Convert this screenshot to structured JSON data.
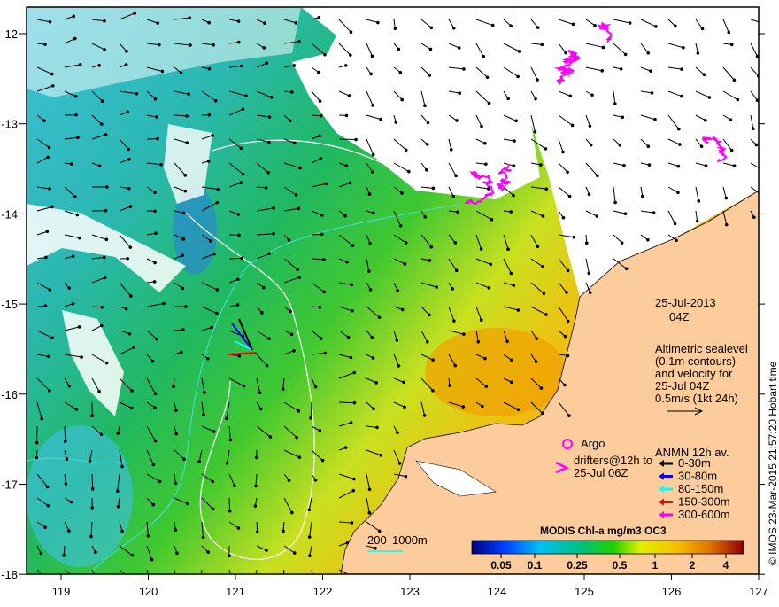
{
  "axes": {
    "lon_ticks": [
      "119",
      "120",
      "121",
      "122",
      "123",
      "124",
      "125",
      "126",
      "127"
    ],
    "lat_ticks": [
      "-12",
      "-13",
      "-14",
      "-15",
      "-16",
      "-17",
      "-18"
    ]
  },
  "date": {
    "day": "25-Jul-2013",
    "time": "04Z"
  },
  "altimetry_note": [
    "Altimetric sealevel",
    "(0.1m contours)",
    "and velocity for",
    "25-Jul 04Z",
    "0.5m/s (1kt 24h)"
  ],
  "argo_label": "Argo",
  "drifters_label": [
    "drifters@12h to",
    "25-Jul 06Z"
  ],
  "anmn": {
    "title": "ANMN 12h av.",
    "items": [
      {
        "label": "0-30m",
        "color": "#000000"
      },
      {
        "label": "30-80m",
        "color": "#0000ff"
      },
      {
        "label": "80-150m",
        "color": "#00ffff"
      },
      {
        "label": "150-300m",
        "color": "#ff0000"
      },
      {
        "label": "300-600m",
        "color": "#ff00ff"
      }
    ]
  },
  "bathy_scale": {
    "label_200": "200",
    "label_1000": "1000m"
  },
  "colorbar": {
    "title": "MODIS Chl-a mg/m3 OC3",
    "ticks": [
      "0.05",
      "0.1",
      "0.25",
      "0.5",
      "1",
      "2",
      "4"
    ]
  },
  "credit": "© IMOS 23-Mar-2015 21:57:20 Hobart time",
  "colors": {
    "land": "#fccc9c",
    "drifter": "#ff00ff"
  }
}
